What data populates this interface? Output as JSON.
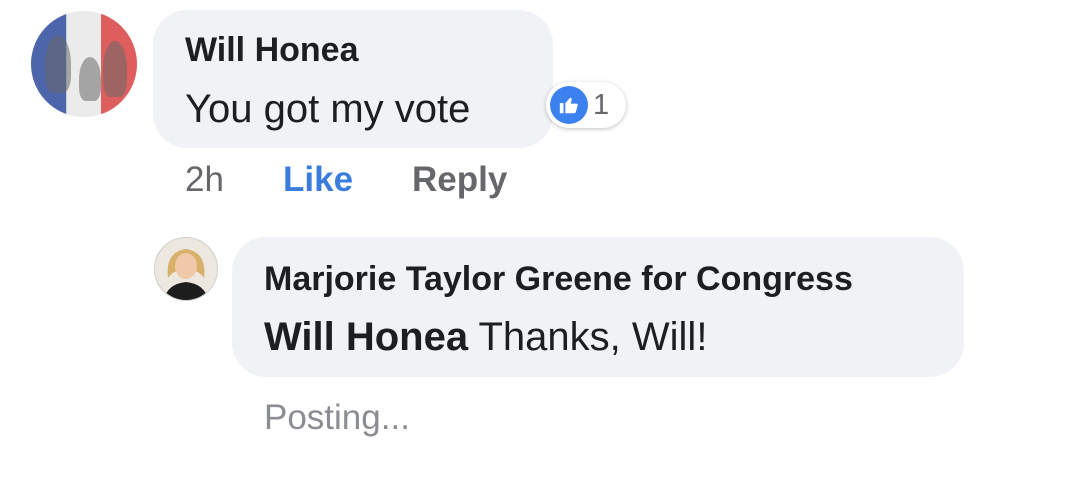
{
  "comment": {
    "author": "Will Honea",
    "text": "You got my vote",
    "reaction_count": "1",
    "timestamp": "2h",
    "like_label": "Like",
    "reply_label": "Reply"
  },
  "reply": {
    "author": "Marjorie Taylor Greene for Congress",
    "mention": "Will Honea",
    "text": " Thanks, Will!",
    "status": "Posting..."
  },
  "colors": {
    "bubble_bg": "#f0f2f5",
    "like_blue": "#3b7ddd",
    "muted_gray": "#65676b"
  },
  "icons": {
    "reaction": "like-thumb-icon"
  }
}
